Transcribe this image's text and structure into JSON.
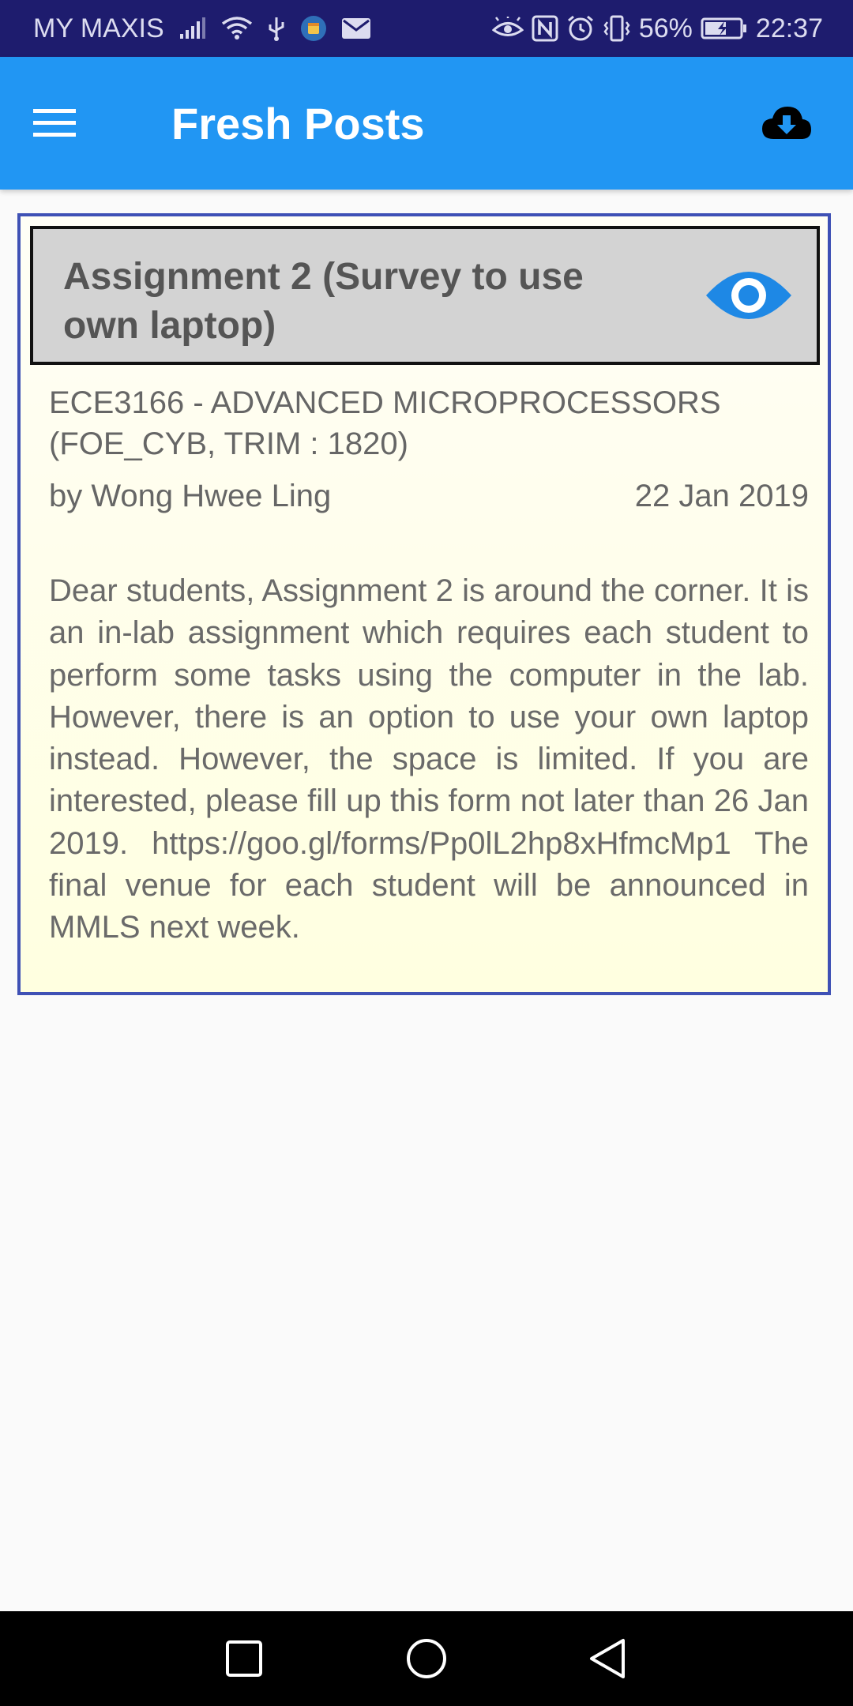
{
  "status_bar": {
    "carrier": "MY MAXIS",
    "battery_percent": "56%",
    "time": "22:37",
    "left_icons": [
      "signal-icon",
      "wifi-icon",
      "usb-icon",
      "calendar-notification-icon",
      "mail-icon"
    ],
    "right_icons": [
      "eye-comfort-icon",
      "nfc-icon",
      "alarm-icon",
      "vibrate-icon",
      "battery-charging-icon"
    ]
  },
  "app_bar": {
    "title": "Fresh Posts",
    "menu_icon": "hamburger-menu-icon",
    "action_icon": "cloud-download-icon",
    "color": "#2196f3"
  },
  "post": {
    "title": "Assignment 2 (Survey to use own laptop)",
    "view_icon": "eye-icon",
    "course": "ECE3166 - ADVANCED MICROPROCESSORS (FOE_CYB, TRIM : 1820)",
    "author": "by Wong Hwee Ling",
    "date": "22 Jan 2019",
    "body": "Dear students, Assignment 2 is around the corner. It is an in-lab assignment which requires each student to perform some tasks using the computer in the lab. However, there is an option to use your own laptop instead. However, the space is limited. If you are interested, please fill up this form not later than 26 Jan 2019. https://goo.gl/forms/Pp0lL2hp8xHfmcMp1  The final venue for each student will be announced in MMLS next week.",
    "border_color": "#3f51b5",
    "accent_color": "#1e88e5"
  },
  "nav_bar": {
    "recents_icon": "square-recents-icon",
    "home_icon": "circle-home-icon",
    "back_icon": "triangle-back-icon"
  }
}
